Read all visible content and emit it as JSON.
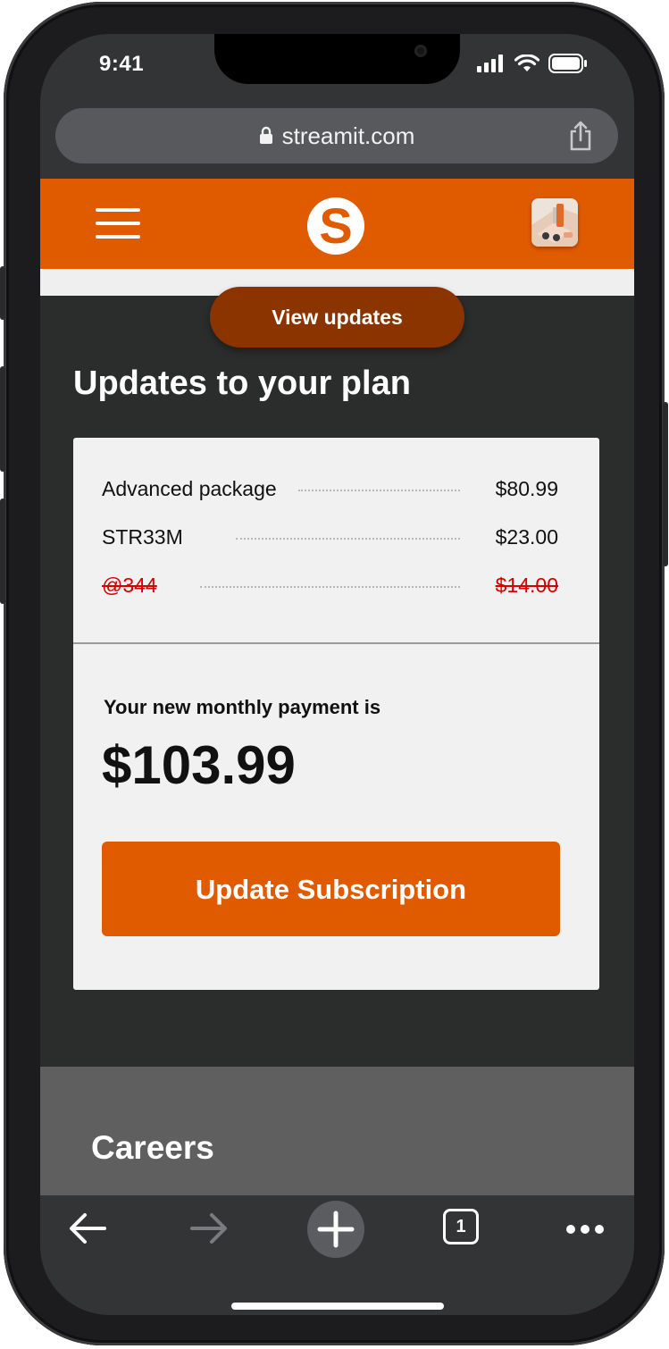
{
  "status_bar": {
    "time": "9:41",
    "icons": [
      "signal-icon",
      "wifi-icon",
      "battery-icon"
    ]
  },
  "browser": {
    "url": "streamit.com",
    "icons": [
      "lock-icon",
      "share-icon"
    ]
  },
  "site_header": {
    "logo_letter": "S",
    "icons": [
      "menu-icon",
      "avatar"
    ],
    "brand_color": "#e05a00"
  },
  "view_updates_label": "View updates",
  "section_title": "Updates to your plan",
  "line_items": [
    {
      "label": "Advanced package",
      "amount": "$80.99",
      "removed": false
    },
    {
      "label": "STR33M",
      "amount": "$23.00",
      "removed": false
    },
    {
      "label": "@344",
      "amount": "$14.00",
      "removed": true
    }
  ],
  "payment": {
    "label": "Your new monthly payment is",
    "amount": "$103.99"
  },
  "update_button_label": "Update Subscription",
  "footer": {
    "title": "Careers"
  },
  "bottom_toolbar": {
    "tab_count": "1",
    "icons": [
      "back-arrow-icon",
      "forward-arrow-icon",
      "new-tab-plus-icon",
      "tabs-icon",
      "more-icon"
    ]
  },
  "colors": {
    "accent": "#e05a00",
    "pill": "#8c3400",
    "removed_text": "#d40000",
    "page_bg": "#2b2c2c"
  }
}
